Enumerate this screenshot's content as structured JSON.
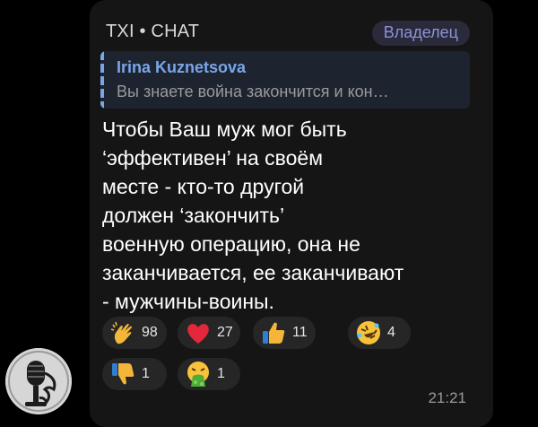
{
  "sender": {
    "name": "TXI • CHAT",
    "role": "Владелец"
  },
  "reply": {
    "author": "Irina Kuznetsova",
    "text": "Вы знаете война закончится и кон…"
  },
  "message": {
    "lines": [
      "Чтобы Ваш муж мог быть",
      "‘эффективен’ на своём",
      "месте - кто-то другой",
      "должен ‘закончить’",
      "военную операцию, она не",
      "заканчивается, ее заканчивают",
      "- мужчины-воины."
    ]
  },
  "reactions": [
    {
      "icon": "clapping-hands-icon",
      "count": "98"
    },
    {
      "icon": "red-heart-icon",
      "count": "27"
    },
    {
      "icon": "thumbs-up-icon",
      "count": "11"
    },
    {
      "icon": "rolling-laughing-icon",
      "count": "4"
    },
    {
      "icon": "thumbs-down-icon",
      "count": "1"
    },
    {
      "icon": "vomiting-face-icon",
      "count": "1"
    }
  ],
  "time": "21:21",
  "avatar": {
    "icon": "microphone-avatar-icon"
  }
}
